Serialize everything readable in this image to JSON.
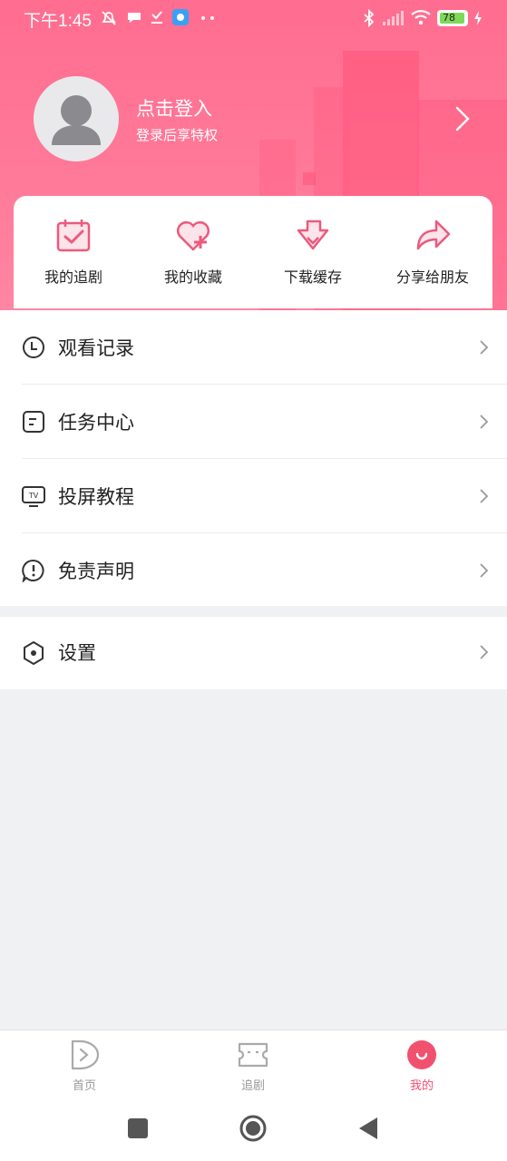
{
  "status_bar": {
    "time": "下午1:45",
    "battery": "78"
  },
  "profile": {
    "login_title": "点击登入",
    "login_subtitle": "登录后享特权"
  },
  "quick_actions": [
    {
      "label": "我的追剧",
      "icon": "calendar-check-icon"
    },
    {
      "label": "我的收藏",
      "icon": "heart-plus-icon"
    },
    {
      "label": "下载缓存",
      "icon": "download-icon"
    },
    {
      "label": "分享给朋友",
      "icon": "share-icon"
    }
  ],
  "menu": [
    {
      "label": "观看记录",
      "icon": "clock-icon"
    },
    {
      "label": "任务中心",
      "icon": "task-icon"
    },
    {
      "label": "投屏教程",
      "icon": "tv-icon"
    },
    {
      "label": "免责声明",
      "icon": "alert-icon"
    }
  ],
  "settings": {
    "label": "设置",
    "icon": "settings-icon"
  },
  "tabbar": {
    "items": [
      {
        "label": "首页",
        "icon": "play-icon",
        "active": false
      },
      {
        "label": "追剧",
        "icon": "ticket-icon",
        "active": false
      },
      {
        "label": "我的",
        "icon": "smile-icon",
        "active": true
      }
    ]
  },
  "colors": {
    "accent": "#f2506f",
    "header": "#ff7a99"
  }
}
